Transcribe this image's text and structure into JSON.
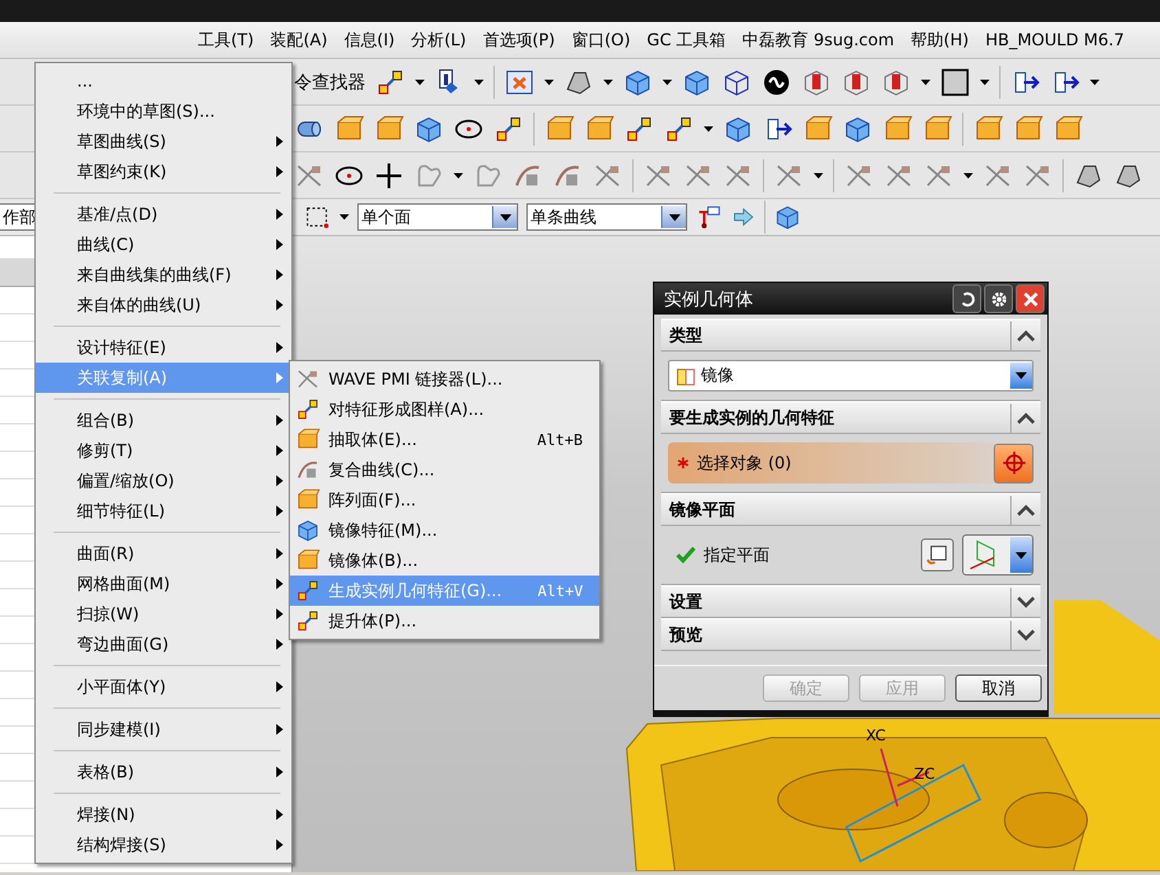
{
  "menubar": [
    {
      "label": "工具(T)"
    },
    {
      "label": "装配(A)"
    },
    {
      "label": "信息(I)"
    },
    {
      "label": "分析(L)"
    },
    {
      "label": "首选项(P)"
    },
    {
      "label": "窗口(O)"
    },
    {
      "label": "GC 工具箱"
    },
    {
      "label": "中磊教育 9sug.com"
    },
    {
      "label": "帮助(H)"
    },
    {
      "label": "HB_MOULD M6.7"
    }
  ],
  "toolbar": {
    "command_finder": "令查找器"
  },
  "selection_bar": {
    "part_field": "作部",
    "filters": [
      {
        "value": "单个面"
      },
      {
        "value": "单条曲线"
      }
    ]
  },
  "menu": {
    "items": [
      {
        "kind": "item",
        "label": "...",
        "submenu": false,
        "selected": false
      },
      {
        "kind": "item",
        "label": "环境中的草图(S)...",
        "submenu": false,
        "selected": false
      },
      {
        "kind": "item",
        "label": "草图曲线(S)",
        "submenu": true,
        "selected": false
      },
      {
        "kind": "item",
        "label": "草图约束(K)",
        "submenu": true,
        "selected": false
      },
      {
        "kind": "separator"
      },
      {
        "kind": "item",
        "label": "基准/点(D)",
        "submenu": true,
        "selected": false
      },
      {
        "kind": "item",
        "label": "曲线(C)",
        "submenu": true,
        "selected": false
      },
      {
        "kind": "item",
        "label": "来自曲线集的曲线(F)",
        "submenu": true,
        "selected": false
      },
      {
        "kind": "item",
        "label": "来自体的曲线(U)",
        "submenu": true,
        "selected": false
      },
      {
        "kind": "separator"
      },
      {
        "kind": "item",
        "label": "设计特征(E)",
        "submenu": true,
        "selected": false
      },
      {
        "kind": "item",
        "label": "关联复制(A)",
        "submenu": true,
        "selected": true
      },
      {
        "kind": "separator"
      },
      {
        "kind": "item",
        "label": "组合(B)",
        "submenu": true,
        "selected": false
      },
      {
        "kind": "item",
        "label": "修剪(T)",
        "submenu": true,
        "selected": false
      },
      {
        "kind": "item",
        "label": "偏置/缩放(O)",
        "submenu": true,
        "selected": false
      },
      {
        "kind": "item",
        "label": "细节特征(L)",
        "submenu": true,
        "selected": false
      },
      {
        "kind": "separator"
      },
      {
        "kind": "item",
        "label": "曲面(R)",
        "submenu": true,
        "selected": false
      },
      {
        "kind": "item",
        "label": "网格曲面(M)",
        "submenu": true,
        "selected": false
      },
      {
        "kind": "item",
        "label": "扫掠(W)",
        "submenu": true,
        "selected": false
      },
      {
        "kind": "item",
        "label": "弯边曲面(G)",
        "submenu": true,
        "selected": false
      },
      {
        "kind": "separator"
      },
      {
        "kind": "item",
        "label": "小平面体(Y)",
        "submenu": true,
        "selected": false
      },
      {
        "kind": "separator"
      },
      {
        "kind": "item",
        "label": "同步建模(I)",
        "submenu": true,
        "selected": false
      },
      {
        "kind": "separator"
      },
      {
        "kind": "item",
        "label": "表格(B)",
        "submenu": true,
        "selected": false
      },
      {
        "kind": "separator"
      },
      {
        "kind": "item",
        "label": "焊接(N)",
        "submenu": true,
        "selected": false
      },
      {
        "kind": "item",
        "label": "结构焊接(S)",
        "submenu": true,
        "selected": false
      }
    ]
  },
  "submenu": {
    "items": [
      {
        "label": "WAVE PMI 链接器(L)...",
        "selected": false
      },
      {
        "label": "对特征形成图样(A)...",
        "selected": false
      },
      {
        "label": "抽取体(E)...",
        "shortcut": "Alt+B",
        "selected": false
      },
      {
        "label": "复合曲线(C)...",
        "selected": false
      },
      {
        "label": "阵列面(F)...",
        "selected": false
      },
      {
        "label": "镜像特征(M)...",
        "selected": false
      },
      {
        "label": "镜像体(B)...",
        "selected": false
      },
      {
        "label": "生成实例几何特征(G)...",
        "shortcut": "Alt+V",
        "selected": true
      },
      {
        "label": "提升体(P)...",
        "selected": false
      }
    ]
  },
  "dialog": {
    "title": "实例几何体",
    "sections": [
      {
        "title": "类型",
        "expanded": true,
        "kind": "dropdown",
        "value": "镜像"
      },
      {
        "title": "要生成实例的几何特征",
        "expanded": true,
        "kind": "selection",
        "label": "选择对象 (0)",
        "required": true
      },
      {
        "title": "镜像平面",
        "expanded": true,
        "kind": "plane",
        "label": "指定平面",
        "done": true
      },
      {
        "title": "设置",
        "expanded": false
      },
      {
        "title": "预览",
        "expanded": false
      }
    ],
    "buttons": [
      {
        "label": "确定",
        "disabled": true
      },
      {
        "label": "应用",
        "disabled": true
      },
      {
        "label": "取消",
        "disabled": false
      }
    ]
  },
  "viewport": {
    "axis_labels": [
      "XC",
      "ZC"
    ]
  }
}
